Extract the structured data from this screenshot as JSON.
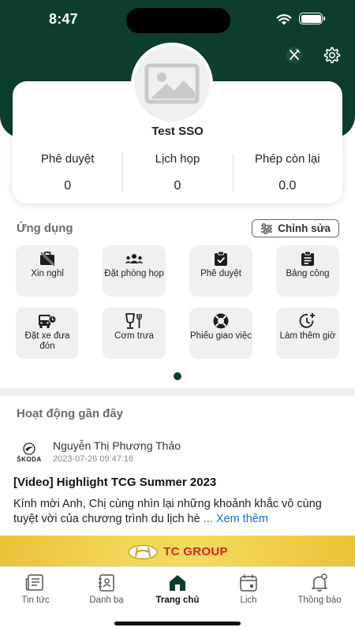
{
  "status_bar": {
    "time": "8:47"
  },
  "header": {
    "icons": [
      "utensils-icon",
      "gear-icon"
    ]
  },
  "profile": {
    "name": "Test SSO",
    "stats": [
      {
        "label": "Phê duyệt",
        "value": "0"
      },
      {
        "label": "Lịch họp",
        "value": "0"
      },
      {
        "label": "Phép còn lại",
        "value": "0.0"
      }
    ]
  },
  "apps": {
    "title": "Ứng dụng",
    "edit_label": "Chỉnh sửa",
    "items": [
      {
        "label": "Xin nghỉ",
        "icon": "briefcase-off-icon"
      },
      {
        "label": "Đặt phòng họp",
        "icon": "people-icon"
      },
      {
        "label": "Phê duyệt",
        "icon": "clipboard-check-icon"
      },
      {
        "label": "Bảng công",
        "icon": "clipboard-list-icon"
      },
      {
        "label": "Đặt xe đưa đón",
        "icon": "bus-clock-icon"
      },
      {
        "label": "Cơm trưa",
        "icon": "cup-fork-icon"
      },
      {
        "label": "Phiếu giao việc",
        "icon": "lifebuoy-icon"
      },
      {
        "label": "Làm thêm giờ",
        "icon": "clock-plus-icon"
      }
    ]
  },
  "activity": {
    "title": "Hoạt động gần đây",
    "post": {
      "logo_text": "ŠKODA",
      "author": "Nguyễn Thị Phương Thảo",
      "time": "2023-07-26 09:47:16",
      "title": "[Video] Highlight TCG Summer 2023",
      "excerpt": "Kính mời Anh, Chị cùng nhìn lại những khoảnh khắc vô cùng tuyệt vời của chương trình du lịch hè",
      "more": "... Xem thêm"
    }
  },
  "banner": {
    "brand": "TC GROUP"
  },
  "bottom_nav": [
    {
      "label": "Tin tức",
      "icon": "news-icon",
      "active": false
    },
    {
      "label": "Danh bạ",
      "icon": "contacts-icon",
      "active": false
    },
    {
      "label": "Trang chủ",
      "icon": "home-icon",
      "active": true
    },
    {
      "label": "Lịch",
      "icon": "calendar-icon",
      "active": false
    },
    {
      "label": "Thông báo",
      "icon": "bell-icon",
      "active": false
    }
  ],
  "colors": {
    "brand_green": "#0d3d2c",
    "link_blue": "#1a6fd1",
    "banner_yellow": "#f3d557",
    "brand_red": "#d8262a"
  }
}
